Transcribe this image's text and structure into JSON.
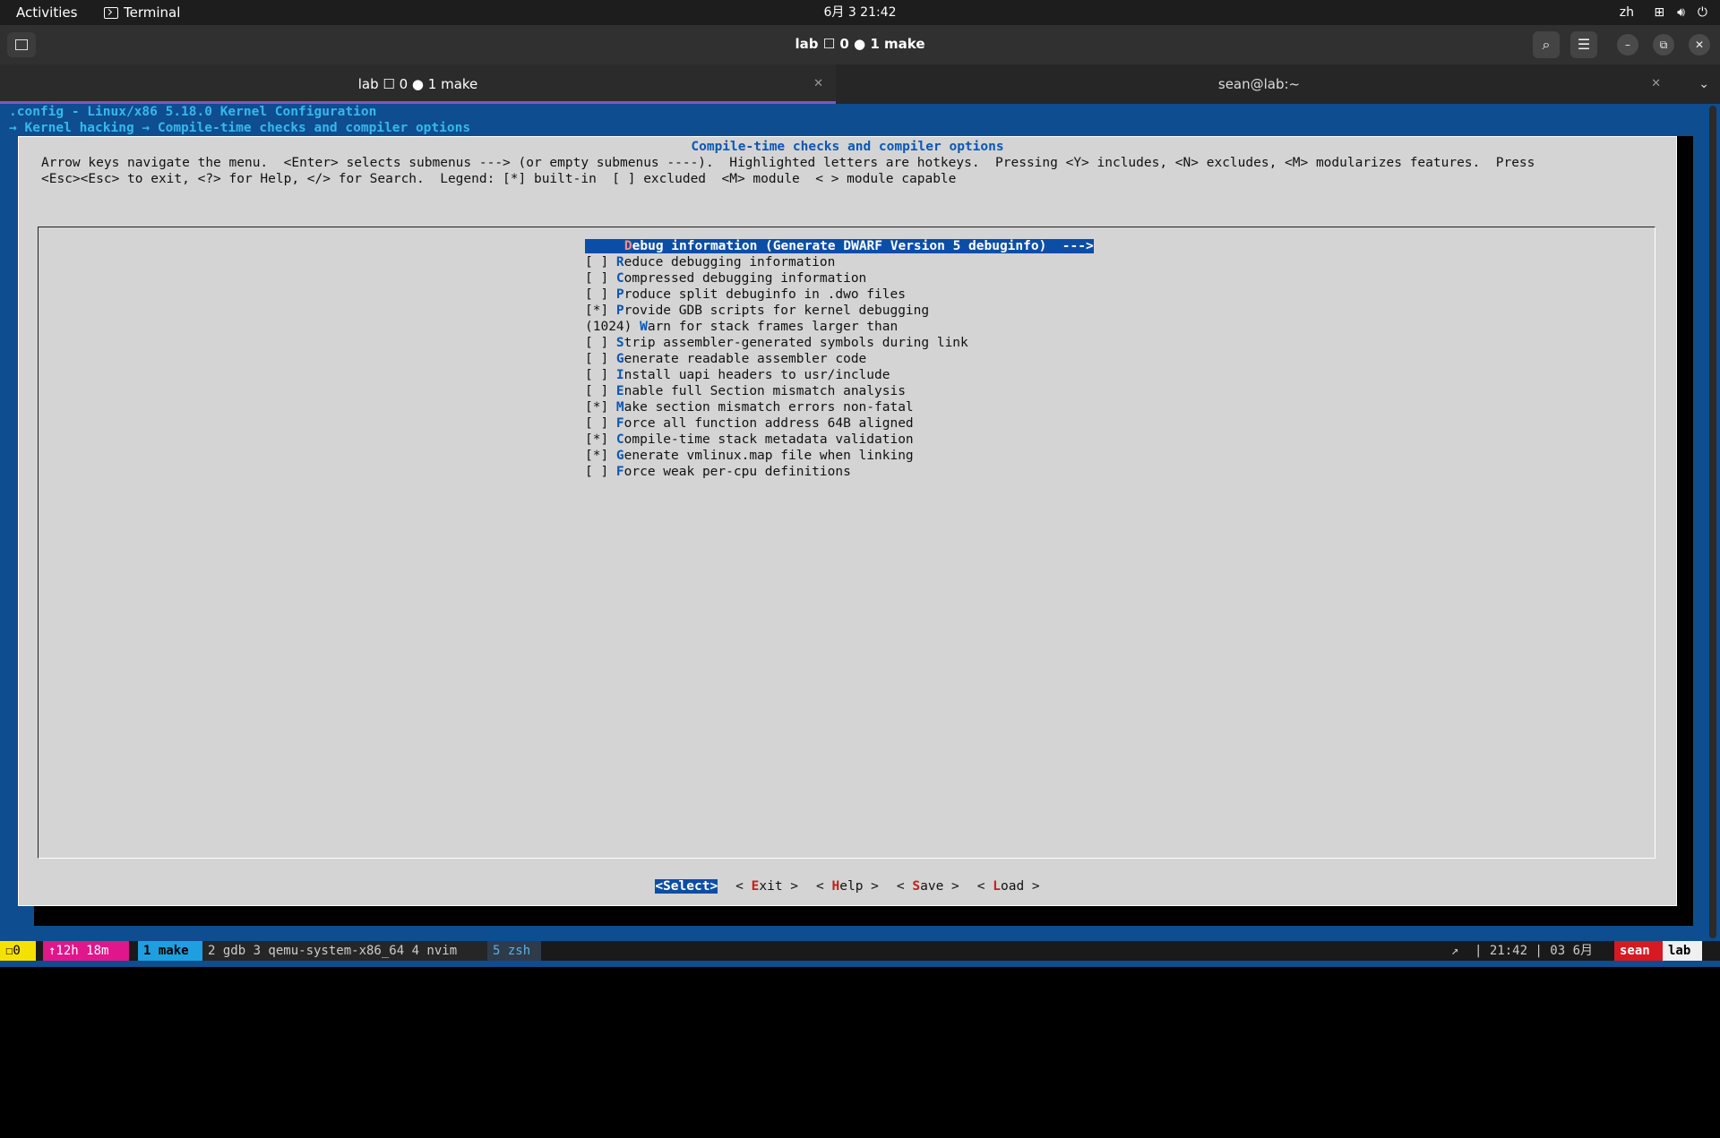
{
  "topbar": {
    "activities": "Activities",
    "app_name": "Terminal",
    "clock": "6月 3  21:42",
    "lang": "zh"
  },
  "window": {
    "title": "lab ☐ 0 ● 1 make"
  },
  "tabs": [
    {
      "label": "lab ☐ 0 ● 1 make",
      "active": true
    },
    {
      "label": "sean@lab:~",
      "active": false
    }
  ],
  "terminal": {
    "config_line": ".config - Linux/x86 5.18.0 Kernel Configuration",
    "breadcrumb": "→ Kernel hacking → Compile-time checks and compiler options",
    "dialog_title": "Compile-time checks and compiler options",
    "help_line1": "Arrow keys navigate the menu.  <Enter> selects submenus ---> (or empty submenus ----).  Highlighted letters are hotkeys.  Pressing <Y> includes, <N> excludes, <M> modularizes features.  Press",
    "help_line2": "<Esc><Esc> to exit, <?> for Help, </> for Search.  Legend: [*] built-in  [ ] excluded  <M> module  < > module capable",
    "menu_items": [
      {
        "prefix": "    ",
        "hot": "D",
        "rest": "ebug information (Generate DWARF Version 5 debuginfo)  --->",
        "selected": true
      },
      {
        "prefix": "[ ] ",
        "hot": "R",
        "rest": "educe debugging information",
        "selected": false
      },
      {
        "prefix": "[ ] ",
        "hot": "C",
        "rest": "ompressed debugging information",
        "selected": false
      },
      {
        "prefix": "[ ] ",
        "hot": "P",
        "rest": "roduce split debuginfo in .dwo files",
        "selected": false
      },
      {
        "prefix": "[*] ",
        "hot": "P",
        "rest": "rovide GDB scripts for kernel debugging",
        "selected": false
      },
      {
        "prefix": "(1024) ",
        "hot": "W",
        "rest": "arn for stack frames larger than",
        "selected": false
      },
      {
        "prefix": "[ ] ",
        "hot": "S",
        "rest": "trip assembler-generated symbols during link",
        "selected": false
      },
      {
        "prefix": "[ ] ",
        "hot": "G",
        "rest": "enerate readable assembler code",
        "selected": false
      },
      {
        "prefix": "[ ] ",
        "hot": "I",
        "rest": "nstall uapi headers to usr/include",
        "selected": false
      },
      {
        "prefix": "[ ] ",
        "hot": "E",
        "rest": "nable full Section mismatch analysis",
        "selected": false
      },
      {
        "prefix": "[*] ",
        "hot": "M",
        "rest": "ake section mismatch errors non-fatal",
        "selected": false
      },
      {
        "prefix": "[ ] ",
        "hot": "F",
        "rest": "orce all function address 64B aligned",
        "selected": false
      },
      {
        "prefix": "[*] ",
        "hot": "C",
        "rest": "ompile-time stack metadata validation",
        "selected": false
      },
      {
        "prefix": "[*] ",
        "hot": "G",
        "rest": "enerate vmlinux.map file when linking",
        "selected": false
      },
      {
        "prefix": "[ ] ",
        "hot": "F",
        "rest": "orce weak per-cpu definitions",
        "selected": false
      }
    ],
    "buttons": [
      {
        "open": "<",
        "hot": "S",
        "rest": "elect",
        "close": ">",
        "selected": true
      },
      {
        "open": "< ",
        "hot": "E",
        "rest": "xit",
        "close": " >",
        "selected": false
      },
      {
        "open": "< ",
        "hot": "H",
        "rest": "elp",
        "close": " >",
        "selected": false
      },
      {
        "open": "< ",
        "hot": "S",
        "rest": "ave",
        "close": " >",
        "selected": false
      },
      {
        "open": "< ",
        "hot": "L",
        "rest": "oad",
        "close": " >",
        "selected": false
      }
    ]
  },
  "tmux": {
    "session_pane": "☐0",
    "uptime": "↑12h 18m",
    "window_active": "1 make",
    "windows_other": "2 gdb 3 qemu-system-x86_64 4 nvim",
    "window_zsh": "5 zsh",
    "right_arrow": "↗",
    "right_info": "| 21:42 | 03 6月",
    "user": "sean",
    "host": "lab"
  },
  "colors": {
    "terminal_bg": "#0e4d8f",
    "dialog_bg": "#d4d4d4",
    "accent_blue": "#0b57b5",
    "hotkey_red": "#c41e1e",
    "tab_accent": "#7e57c2",
    "tmux_yellow": "#f5e100",
    "tmux_magenta": "#e0168c",
    "tmux_cyan": "#1e9fe0",
    "tmux_red": "#d71921"
  }
}
